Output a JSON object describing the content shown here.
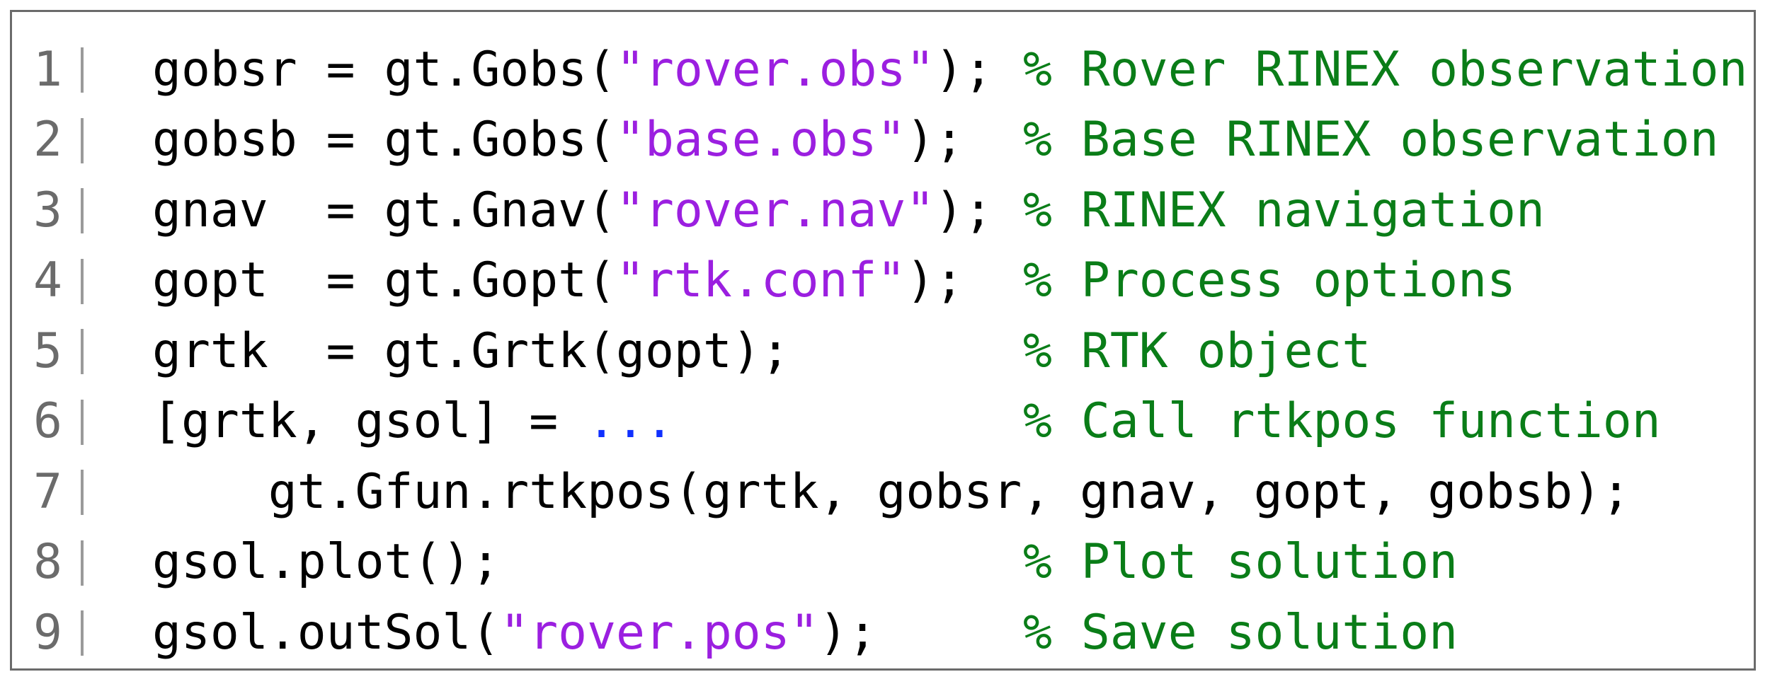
{
  "colors": {
    "border": "#6b6b6b",
    "line_number": "#6b6b6b",
    "code": "#000000",
    "string": "#9b1fe0",
    "comment": "#0a7d18",
    "continuation": "#1030ff"
  },
  "lines": [
    {
      "num": "1",
      "code_pre": "gobsr = gt.Gobs(",
      "code_str": "\"rover.obs\"",
      "code_post": ");",
      "comment": "% Rover RINEX observation"
    },
    {
      "num": "2",
      "code_pre": "gobsb = gt.Gobs(",
      "code_str": "\"base.obs\"",
      "code_post": ");",
      "comment": "% Base RINEX observation"
    },
    {
      "num": "3",
      "code_pre": "gnav  = gt.Gnav(",
      "code_str": "\"rover.nav\"",
      "code_post": ");",
      "comment": "% RINEX navigation"
    },
    {
      "num": "4",
      "code_pre": "gopt  = gt.Gopt(",
      "code_str": "\"rtk.conf\"",
      "code_post": ");",
      "comment": "% Process options"
    },
    {
      "num": "5",
      "code_pre": "grtk  = gt.Grtk(gopt);",
      "comment": "% RTK object"
    },
    {
      "num": "6",
      "code_pre": "[grtk, gsol] = ",
      "code_cont": "...",
      "comment": "% Call rtkpos function"
    },
    {
      "num": "7",
      "code_pre": "    gt.Gfun.rtkpos(grtk, gobsr, gnav, gopt, gobsb);"
    },
    {
      "num": "8",
      "code_pre": "gsol.plot();",
      "comment": "% Plot solution"
    },
    {
      "num": "9",
      "code_pre": "gsol.outSol(",
      "code_str": "\"rover.pos\"",
      "code_post": ");",
      "comment": "% Save solution"
    }
  ]
}
